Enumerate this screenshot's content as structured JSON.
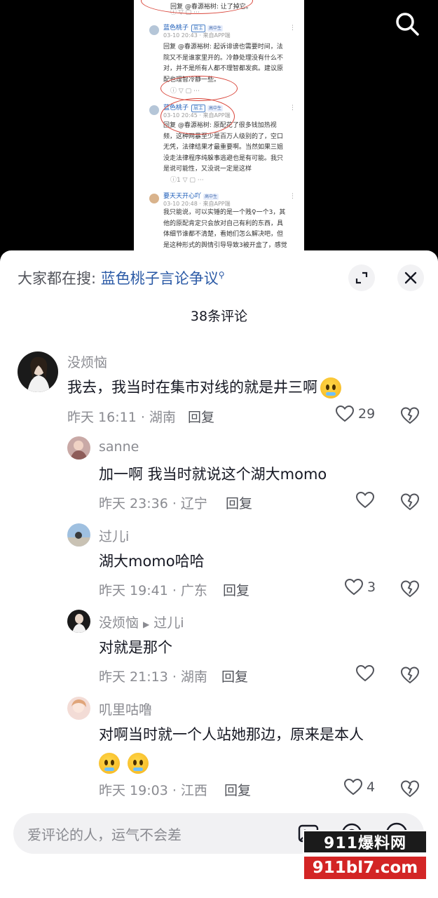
{
  "video_frame": {
    "top_reply": "回复 @春源裕树: 让了掉它。",
    "comments": [
      {
        "name": "蓝色桃子",
        "badge": "层主",
        "tag": "高中生",
        "meta": "03-10 20:43 · 来自APP端",
        "body_lines": [
          "回复 @春源裕树: 起诉诽谤也需要时间，法",
          "院又不是谁家里开的。冷静处理没有什么不",
          "对，并不是所有人都不理智都发疯。建议原",
          "配也理智冷静一些。"
        ]
      },
      {
        "name": "蓝色桃子",
        "badge": "层主",
        "tag": "高中生",
        "meta": "03-10 20:45 · 来自APP端",
        "body_lines": [
          "回复 @春源裕树: 原配花了很多钱加热视",
          "频，这种网暴至少是百万人级别的了，空口",
          "无凭，法律结果才最重要啊。当然如果三姐",
          "没走法律程序纯躲事逃避也是有可能。我只",
          "是说可能性，又没说一定是这样"
        ],
        "like_count": "1"
      },
      {
        "name": "要天天开心吖",
        "tag": "高中生",
        "meta": "03-10 20:48 · 来自APP端",
        "body_lines": [
          "我只能说，可以实锤的是一个贱♀一个3，其",
          "他的原配肯定只会放对自己有利的东西，具",
          "体细节谁都不清楚，看她们怎么解决吧，但",
          "是这种形式的舆情引导导致3被开盒了，感觉"
        ]
      }
    ]
  },
  "search_hint": {
    "label": "大家都在搜: ",
    "term": "蓝色桃子言论争议",
    "suffix_icon": "search-small-icon"
  },
  "comment_count": "38条评论",
  "comments": [
    {
      "name": "没烦恼",
      "text": "我去，我当时在集市对线的就是井三啊",
      "emoji": "laughing-crying-emoji",
      "meta": "昨天 16:11 · 湖南",
      "reply": "回复",
      "likes": "29"
    },
    {
      "name": "sanne",
      "text": "加一啊 我当时就说这个湖大momo",
      "meta": "昨天 23:36 · 辽宁",
      "reply": "回复",
      "likes": ""
    },
    {
      "name": "过儿i",
      "text": "湖大momo哈哈",
      "meta": "昨天 19:41 · 广东",
      "reply": "回复",
      "likes": "3"
    },
    {
      "name": "没烦恼",
      "reply_to": "过儿i",
      "text": "对就是那个",
      "meta": "昨天 21:13 · 湖南",
      "reply": "回复",
      "likes": ""
    },
    {
      "name": "叽里咕噜",
      "text": "对啊当时就一个人站她那边，原来是本人",
      "emoji": "pleading-face-emoji",
      "meta": "昨天 19:03 · 江西",
      "reply": "回复",
      "likes": "4"
    }
  ],
  "input": {
    "placeholder": "爱评论的人，运气不会差"
  },
  "watermark": {
    "top": "911爆料网",
    "bottom": "911bl7.com"
  },
  "colors": {
    "accent_link": "#2b5aa6",
    "secondary_text": "#8a8b91",
    "annotation_red": "#d9453a",
    "watermark_red": "#d32525"
  }
}
